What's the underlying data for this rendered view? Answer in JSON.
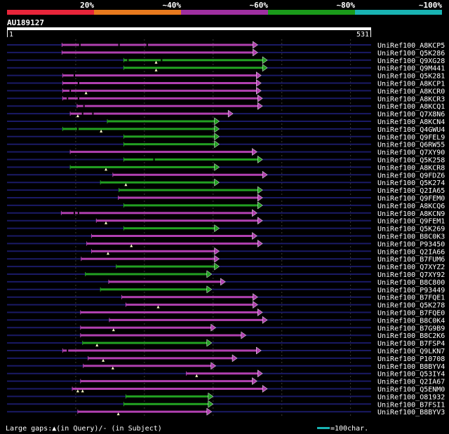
{
  "colors": {
    "background": "#000000",
    "query": "#ffffff",
    "scale_red": "#e8253a",
    "scale_orange": "#e87a1e",
    "scale_purple": "#9e2fa0",
    "scale_green": "#1a9a1a",
    "scale_cyan": "#19b3b3",
    "hit_purple": "#b040b0",
    "hit_green": "#22a022",
    "unaligned": "#1a1a66",
    "gridline": "#3a3a3a",
    "text": "#ffffff"
  },
  "chart_data": {
    "type": "alignment",
    "query_name": "AU189127",
    "query_length": 531,
    "ruler_start": "1",
    "ruler_end": "531",
    "identity_scale": [
      {
        "label": "20%",
        "color": "#e8253a"
      },
      {
        "label": "~40%",
        "color": "#e87a1e"
      },
      {
        "label": "~60%",
        "color": "#9e2fa0"
      },
      {
        "label": "~80%",
        "color": "#1a9a1a"
      },
      {
        "label": "~100%",
        "color": "#19b3b3"
      }
    ],
    "hits": [
      {
        "name": "UniRef100_A8KCP5",
        "start": 81,
        "end": 366,
        "identity": "~60%",
        "gaps": [
          [
            106,
            108
          ],
          [
            163,
            165
          ],
          [
            204,
            206
          ]
        ],
        "marks": []
      },
      {
        "name": "UniRef100_Q5K286",
        "start": 81,
        "end": 366,
        "identity": "~60%",
        "gaps": [],
        "marks": []
      },
      {
        "name": "UniRef100_Q9XG28",
        "start": 171,
        "end": 380,
        "identity": "~80%",
        "gaps": [
          [
            176,
            178
          ],
          [
            225,
            227
          ]
        ],
        "marks": [
          218
        ]
      },
      {
        "name": "UniRef100_Q9M441",
        "start": 171,
        "end": 380,
        "identity": "~80%",
        "gaps": [],
        "marks": [
          218
        ]
      },
      {
        "name": "UniRef100_Q5K281",
        "start": 82,
        "end": 371,
        "identity": "~60%",
        "gaps": [
          [
            98,
            100
          ]
        ],
        "marks": []
      },
      {
        "name": "UniRef100_A8KCP1",
        "start": 82,
        "end": 371,
        "identity": "~60%",
        "gaps": [
          [
            104,
            106
          ]
        ],
        "marks": []
      },
      {
        "name": "UniRef100_A8KCR0",
        "start": 82,
        "end": 371,
        "identity": "~60%",
        "gaps": [
          [
            92,
            94
          ]
        ],
        "marks": [
          116
        ]
      },
      {
        "name": "UniRef100_A8KCR3",
        "start": 82,
        "end": 373,
        "identity": "~60%",
        "gaps": [
          [
            88,
            90
          ],
          [
            104,
            106
          ]
        ],
        "marks": []
      },
      {
        "name": "UniRef100_A8KCQ1",
        "start": 103,
        "end": 373,
        "identity": "~60%",
        "gaps": [
          [
            112,
            114
          ]
        ],
        "marks": []
      },
      {
        "name": "UniRef100_Q7X8N6",
        "start": 93,
        "end": 330,
        "identity": "~60%",
        "gaps": [
          [
            110,
            112
          ],
          [
            125,
            127
          ]
        ],
        "marks": [
          104
        ]
      },
      {
        "name": "UniRef100_A8KCN4",
        "start": 147,
        "end": 310,
        "identity": "~80%",
        "gaps": [],
        "marks": []
      },
      {
        "name": "UniRef100_Q4GWU4",
        "start": 82,
        "end": 310,
        "identity": "~80%",
        "gaps": [
          [
            103,
            105
          ]
        ],
        "marks": [
          138
        ]
      },
      {
        "name": "UniRef100_Q9FEL9",
        "start": 171,
        "end": 310,
        "identity": "~80%",
        "gaps": [],
        "marks": []
      },
      {
        "name": "UniRef100_Q6RW55",
        "start": 171,
        "end": 310,
        "identity": "~80%",
        "gaps": [],
        "marks": []
      },
      {
        "name": "UniRef100_Q7XY90",
        "start": 93,
        "end": 365,
        "identity": "~60%",
        "gaps": [],
        "marks": []
      },
      {
        "name": "UniRef100_Q5K258",
        "start": 171,
        "end": 373,
        "identity": "~80%",
        "gaps": [
          [
            214,
            216
          ]
        ],
        "marks": []
      },
      {
        "name": "UniRef100_A8KCR8",
        "start": 93,
        "end": 310,
        "identity": "~80%",
        "gaps": [],
        "marks": [
          145
        ]
      },
      {
        "name": "UniRef100_Q9FDZ6",
        "start": 155,
        "end": 380,
        "identity": "~60%",
        "gaps": [],
        "marks": []
      },
      {
        "name": "UniRef100_Q5K274",
        "start": 137,
        "end": 310,
        "identity": "~80%",
        "gaps": [],
        "marks": [
          174
        ]
      },
      {
        "name": "UniRef100_Q2IA65",
        "start": 164,
        "end": 373,
        "identity": "~80%",
        "gaps": [],
        "marks": []
      },
      {
        "name": "UniRef100_Q9FEM0",
        "start": 163,
        "end": 373,
        "identity": "~60%",
        "gaps": [],
        "marks": []
      },
      {
        "name": "UniRef100_A8KCQ6",
        "start": 171,
        "end": 373,
        "identity": "~80%",
        "gaps": [],
        "marks": []
      },
      {
        "name": "UniRef100_A8KCN9",
        "start": 80,
        "end": 365,
        "identity": "~60%",
        "gaps": [
          [
            98,
            100
          ],
          [
            104,
            106
          ]
        ],
        "marks": []
      },
      {
        "name": "UniRef100_Q9FEM1",
        "start": 131,
        "end": 373,
        "identity": "~60%",
        "gaps": [],
        "marks": [
          145
        ]
      },
      {
        "name": "UniRef100_Q5K269",
        "start": 171,
        "end": 310,
        "identity": "~80%",
        "gaps": [],
        "marks": []
      },
      {
        "name": "UniRef100_B8C0K3",
        "start": 124,
        "end": 365,
        "identity": "~60%",
        "gaps": [],
        "marks": []
      },
      {
        "name": "UniRef100_P93450",
        "start": 117,
        "end": 373,
        "identity": "~60%",
        "gaps": [],
        "marks": [
          182
        ]
      },
      {
        "name": "UniRef100_Q2IA66",
        "start": 124,
        "end": 310,
        "identity": "~60%",
        "gaps": [],
        "marks": [
          148
        ]
      },
      {
        "name": "UniRef100_B7FUM6",
        "start": 109,
        "end": 310,
        "identity": "~60%",
        "gaps": [],
        "marks": []
      },
      {
        "name": "UniRef100_Q7XYZ2",
        "start": 160,
        "end": 310,
        "identity": "~80%",
        "gaps": [],
        "marks": []
      },
      {
        "name": "UniRef100_Q7XY92",
        "start": 115,
        "end": 299,
        "identity": "~80%",
        "gaps": [],
        "marks": []
      },
      {
        "name": "UniRef100_B8C800",
        "start": 149,
        "end": 319,
        "identity": "~60%",
        "gaps": [],
        "marks": []
      },
      {
        "name": "UniRef100_P93449",
        "start": 137,
        "end": 299,
        "identity": "~80%",
        "gaps": [],
        "marks": []
      },
      {
        "name": "UniRef100_B7FQE1",
        "start": 168,
        "end": 366,
        "identity": "~60%",
        "gaps": [],
        "marks": []
      },
      {
        "name": "UniRef100_Q5K278",
        "start": 174,
        "end": 366,
        "identity": "~60%",
        "gaps": [],
        "marks": [
          221
        ]
      },
      {
        "name": "UniRef100_B7FQE0",
        "start": 108,
        "end": 373,
        "identity": "~60%",
        "gaps": [],
        "marks": []
      },
      {
        "name": "UniRef100_B8C0K4",
        "start": 150,
        "end": 380,
        "identity": "~60%",
        "gaps": [],
        "marks": []
      },
      {
        "name": "UniRef100_B7G9B9",
        "start": 108,
        "end": 305,
        "identity": "~60%",
        "gaps": [],
        "marks": [
          156
        ]
      },
      {
        "name": "UniRef100_B8C2K6",
        "start": 108,
        "end": 349,
        "identity": "~60%",
        "gaps": [],
        "marks": []
      },
      {
        "name": "UniRef100_B7FSP4",
        "start": 111,
        "end": 299,
        "identity": "~80%",
        "gaps": [],
        "marks": [
          132
        ]
      },
      {
        "name": "UniRef100_Q9LKN7",
        "start": 82,
        "end": 371,
        "identity": "~60%",
        "gaps": [
          [
            88,
            90
          ]
        ],
        "marks": []
      },
      {
        "name": "UniRef100_P10708",
        "start": 119,
        "end": 336,
        "identity": "~60%",
        "gaps": [],
        "marks": [
          141
        ]
      },
      {
        "name": "UniRef100_B8BYV4",
        "start": 112,
        "end": 305,
        "identity": "~60%",
        "gaps": [],
        "marks": [
          155
        ]
      },
      {
        "name": "UniRef100_Q53IY4",
        "start": 262,
        "end": 373,
        "identity": "~60%",
        "gaps": [],
        "marks": [
          277
        ]
      },
      {
        "name": "UniRef100_Q2IA67",
        "start": 108,
        "end": 365,
        "identity": "~60%",
        "gaps": [],
        "marks": []
      },
      {
        "name": "UniRef100_Q5ENM0",
        "start": 96,
        "end": 380,
        "identity": "~60%",
        "gaps": [],
        "marks": [
          104,
          111
        ]
      },
      {
        "name": "UniRef100_O81932",
        "start": 174,
        "end": 301,
        "identity": "~80%",
        "gaps": [],
        "marks": []
      },
      {
        "name": "UniRef100_B7FSI1",
        "start": 171,
        "end": 301,
        "identity": "~80%",
        "gaps": [],
        "marks": []
      },
      {
        "name": "UniRef100_B8BYV3",
        "start": 104,
        "end": 299,
        "identity": "~60%",
        "gaps": [],
        "marks": [
          163
        ]
      }
    ],
    "legend": {
      "gaps_label": "Large gaps:",
      "query_gap_glyph": "▲",
      "query_gap_text": "(in Query)",
      "subject_gap_glyph": "/",
      "subject_gap_text": "- (in Subject)",
      "scale_text": "=100char."
    }
  }
}
